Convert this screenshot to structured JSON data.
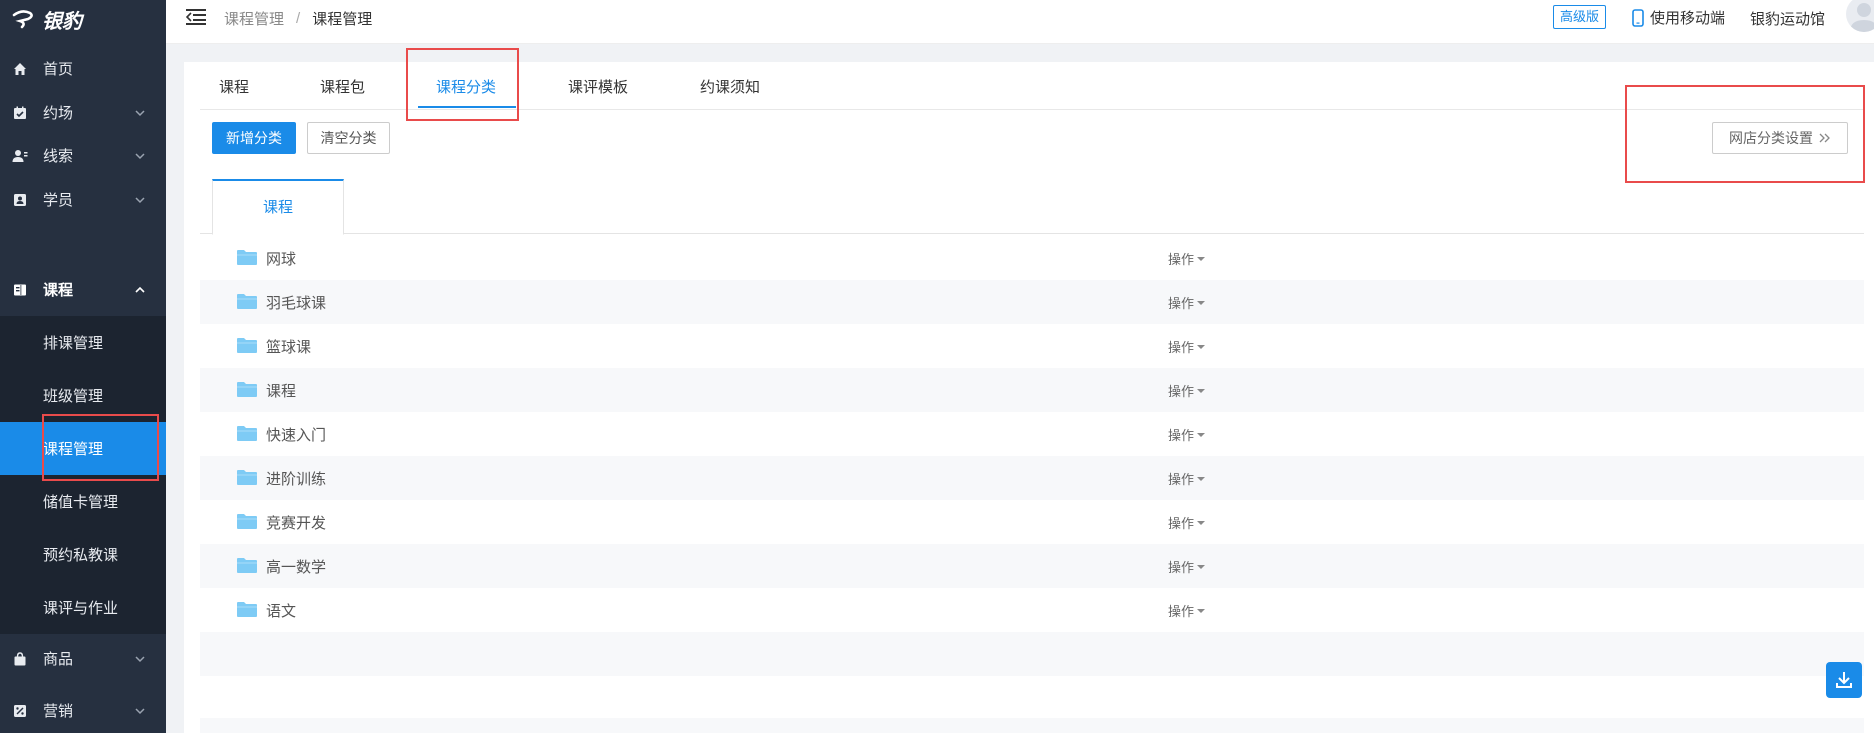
{
  "app": {
    "logo_text": "银豹"
  },
  "sidebar": {
    "items": [
      {
        "label": "首页",
        "icon": "home-icon",
        "has_chevron": false
      },
      {
        "label": "约场",
        "icon": "calendar-check-icon",
        "has_chevron": true
      },
      {
        "label": "线索",
        "icon": "user-lead-icon",
        "has_chevron": true
      },
      {
        "label": "学员",
        "icon": "student-card-icon",
        "has_chevron": true
      },
      {
        "label": "课程",
        "icon": "book-icon",
        "has_chevron": true,
        "expanded": true
      },
      {
        "label": "商品",
        "icon": "bag-icon",
        "has_chevron": true
      },
      {
        "label": "营销",
        "icon": "percent-icon",
        "has_chevron": true
      }
    ],
    "submenu": [
      {
        "label": "排课管理"
      },
      {
        "label": "班级管理"
      },
      {
        "label": "课程管理",
        "active": true
      },
      {
        "label": "储值卡管理"
      },
      {
        "label": "预约私教课"
      },
      {
        "label": "课评与作业"
      }
    ]
  },
  "header": {
    "breadcrumb": {
      "parent": "课程管理",
      "separator": "/",
      "current": "课程管理"
    },
    "edition_badge": "高级版",
    "mobile_link": "使用移动端",
    "venue_name": "银豹运动馆"
  },
  "tabs": [
    {
      "label": "课程"
    },
    {
      "label": "课程包"
    },
    {
      "label": "课程分类",
      "active": true
    },
    {
      "label": "课评模板"
    },
    {
      "label": "约课须知"
    }
  ],
  "toolbar": {
    "add_category": "新增分类",
    "clear_category": "清空分类",
    "store_category_settings": "网店分类设置"
  },
  "subtab": {
    "label": "课程"
  },
  "categories": [
    {
      "name": "网球",
      "action": "操作"
    },
    {
      "name": "羽毛球课",
      "action": "操作"
    },
    {
      "name": "篮球课",
      "action": "操作"
    },
    {
      "name": "课程",
      "action": "操作"
    },
    {
      "name": "快速入门",
      "action": "操作"
    },
    {
      "name": "进阶训练",
      "action": "操作"
    },
    {
      "name": "竞赛开发",
      "action": "操作"
    },
    {
      "name": "高一数学",
      "action": "操作"
    },
    {
      "name": "语文",
      "action": "操作"
    }
  ],
  "colors": {
    "primary": "#1a8be8",
    "sidebar_bg": "#263040",
    "submenu_bg": "#1c2430",
    "highlight": "#e94b4b",
    "folder": "#7ecbf5"
  }
}
